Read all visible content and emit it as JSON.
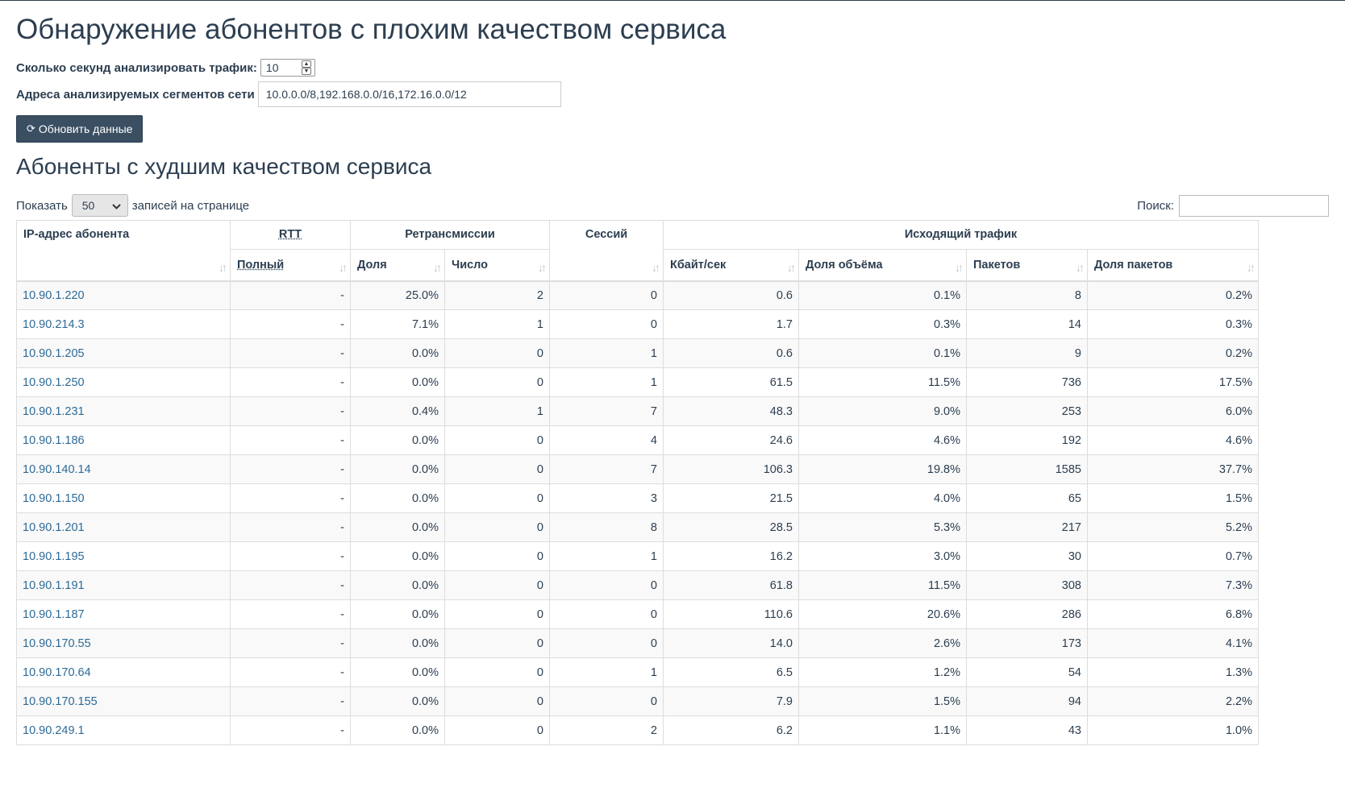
{
  "page_title": "Обнаружение абонентов с плохим качеством сервиса",
  "form": {
    "seconds_label": "Сколько секунд анализировать трафик:",
    "seconds_value": "10",
    "segments_label": "Адреса анализируемых сегментов сети",
    "segments_value": "10.0.0.0/8,192.168.0.0/16,172.16.0.0/12",
    "refresh_button": "Обновить данные",
    "refresh_icon": "refresh-icon"
  },
  "section_title": "Абоненты с худшим качеством сервиса",
  "controls": {
    "show_label": "Показать",
    "page_length": "50",
    "records_label": "записей на странице",
    "search_label": "Поиск:",
    "search_value": ""
  },
  "table": {
    "headers": {
      "ip": "IP-адрес абонента",
      "rtt": "RTT",
      "rtt_full": "Полный",
      "retrans": "Ретрансмиссии",
      "retrans_share": "Доля",
      "retrans_count": "Число",
      "sessions": "Сессий",
      "outgoing": "Исходящий трафик",
      "kbps": "Кбайт/сек",
      "volume_share": "Доля объёма",
      "packets": "Пакетов",
      "packets_share": "Доля пакетов"
    },
    "rows": [
      [
        "10.90.1.220",
        "-",
        "25.0%",
        "2",
        "0",
        "0.6",
        "0.1%",
        "8",
        "0.2%"
      ],
      [
        "10.90.214.3",
        "-",
        "7.1%",
        "1",
        "0",
        "1.7",
        "0.3%",
        "14",
        "0.3%"
      ],
      [
        "10.90.1.205",
        "-",
        "0.0%",
        "0",
        "1",
        "0.6",
        "0.1%",
        "9",
        "0.2%"
      ],
      [
        "10.90.1.250",
        "-",
        "0.0%",
        "0",
        "1",
        "61.5",
        "11.5%",
        "736",
        "17.5%"
      ],
      [
        "10.90.1.231",
        "-",
        "0.4%",
        "1",
        "7",
        "48.3",
        "9.0%",
        "253",
        "6.0%"
      ],
      [
        "10.90.1.186",
        "-",
        "0.0%",
        "0",
        "4",
        "24.6",
        "4.6%",
        "192",
        "4.6%"
      ],
      [
        "10.90.140.14",
        "-",
        "0.0%",
        "0",
        "7",
        "106.3",
        "19.8%",
        "1585",
        "37.7%"
      ],
      [
        "10.90.1.150",
        "-",
        "0.0%",
        "0",
        "3",
        "21.5",
        "4.0%",
        "65",
        "1.5%"
      ],
      [
        "10.90.1.201",
        "-",
        "0.0%",
        "0",
        "8",
        "28.5",
        "5.3%",
        "217",
        "5.2%"
      ],
      [
        "10.90.1.195",
        "-",
        "0.0%",
        "0",
        "1",
        "16.2",
        "3.0%",
        "30",
        "0.7%"
      ],
      [
        "10.90.1.191",
        "-",
        "0.0%",
        "0",
        "0",
        "61.8",
        "11.5%",
        "308",
        "7.3%"
      ],
      [
        "10.90.1.187",
        "-",
        "0.0%",
        "0",
        "0",
        "110.6",
        "20.6%",
        "286",
        "6.8%"
      ],
      [
        "10.90.170.55",
        "-",
        "0.0%",
        "0",
        "0",
        "14.0",
        "2.6%",
        "173",
        "4.1%"
      ],
      [
        "10.90.170.64",
        "-",
        "0.0%",
        "0",
        "1",
        "6.5",
        "1.2%",
        "54",
        "1.3%"
      ],
      [
        "10.90.170.155",
        "-",
        "0.0%",
        "0",
        "0",
        "7.9",
        "1.5%",
        "94",
        "2.2%"
      ],
      [
        "10.90.249.1",
        "-",
        "0.0%",
        "0",
        "2",
        "6.2",
        "1.1%",
        "43",
        "1.0%"
      ]
    ]
  }
}
